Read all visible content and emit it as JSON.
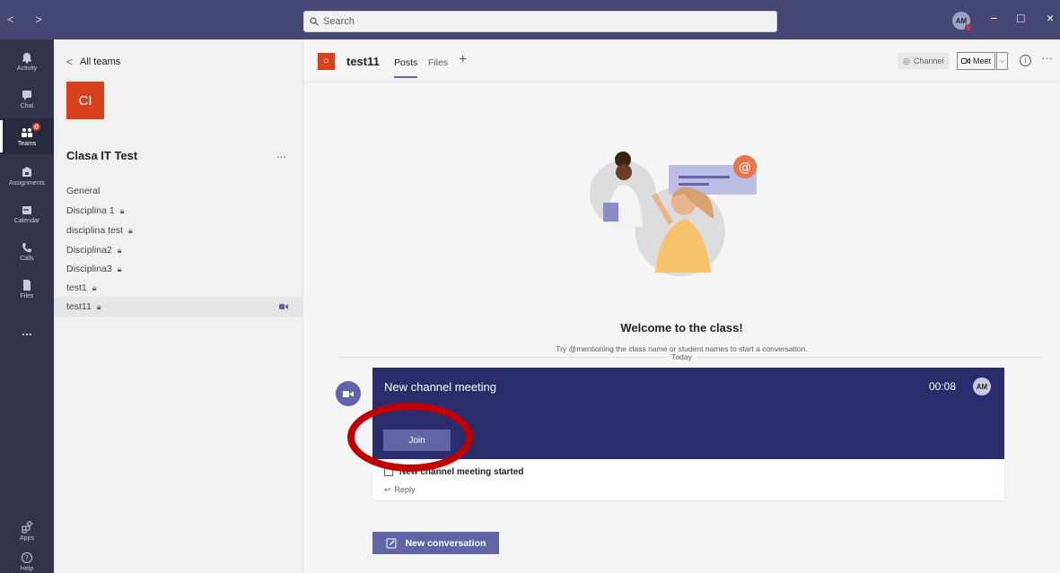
{
  "titlebar": {
    "nav": "< >",
    "search_placeholder": "Search",
    "avatar_initials": "AM",
    "minimize": "−",
    "maximize": "□",
    "close": "×"
  },
  "rail": {
    "items": [
      {
        "label": "Activity",
        "icon": "bell-icon"
      },
      {
        "label": "Chat",
        "icon": "chat-icon"
      },
      {
        "label": "Teams",
        "icon": "teams-icon",
        "active": true,
        "badge": "@"
      },
      {
        "label": "Assignments",
        "icon": "assignments-icon"
      },
      {
        "label": "Calendar",
        "icon": "calendar-icon"
      },
      {
        "label": "Calls",
        "icon": "phone-icon"
      },
      {
        "label": "Files",
        "icon": "file-icon"
      }
    ],
    "more": "...",
    "apps_label": "Apps",
    "help_label": "Help"
  },
  "panel": {
    "back_label": "All teams",
    "team_initials": "CI",
    "team_name": "Clasa IT Test",
    "more": "...",
    "channels": [
      {
        "name": "General",
        "locked": false
      },
      {
        "name": "Disciplina 1",
        "locked": true
      },
      {
        "name": "disciplina test",
        "locked": true
      },
      {
        "name": "Disciplina2",
        "locked": true
      },
      {
        "name": "Disciplina3",
        "locked": true
      },
      {
        "name": "test1",
        "locked": true
      },
      {
        "name": "test11",
        "locked": true,
        "active": true
      }
    ]
  },
  "channel_header": {
    "tile_initials": "CI",
    "name": "test11",
    "tabs": [
      "Posts",
      "Files"
    ],
    "add_tab": "+",
    "channel_button": "Channel",
    "meet_button": "Meet",
    "info": "i",
    "more": "···"
  },
  "welcome": {
    "title": "Welcome to the class!",
    "subtitle": "Try @mentioning the class name or student names to start a conversation.",
    "date_divider": "Today"
  },
  "meeting_card": {
    "title": "New channel meeting",
    "duration": "00:08",
    "avatar_initials": "AM",
    "join_label": "Join",
    "started_text": "New channel meeting started",
    "reply_label": "Reply"
  },
  "compose": {
    "new_conversation_label": "New conversation"
  },
  "colors": {
    "titlebar": "#464775",
    "rail": "#33344a",
    "accent": "#6264a7",
    "card": "#2b2c6b",
    "team_tile": "#d9411e",
    "annotation": "#c00000"
  }
}
